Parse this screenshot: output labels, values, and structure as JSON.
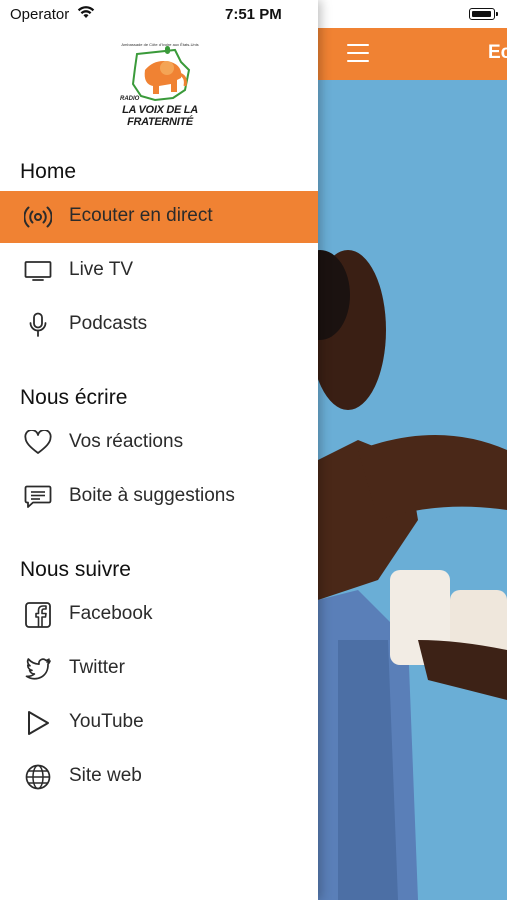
{
  "status_bar": {
    "carrier": "Operator",
    "time": "7:51 PM"
  },
  "logo": {
    "caption": "Ambassade de Côte d'Ivoire aux États-Unis",
    "radio": "RADIO",
    "name_line1": "LA VOIX DE LA",
    "name_line2": "FRATERNITÉ"
  },
  "main": {
    "title": "Ec"
  },
  "sections": {
    "home": "Home",
    "write": "Nous écrire",
    "follow": "Nous suivre"
  },
  "menu": {
    "listen": {
      "label": "Ecouter en direct",
      "icon": "broadcast-icon",
      "active": true
    },
    "livetv": {
      "label": "Live TV",
      "icon": "tv-icon"
    },
    "podcasts": {
      "label": "Podcasts",
      "icon": "microphone-icon"
    },
    "reactions": {
      "label": "Vos réactions",
      "icon": "heart-icon"
    },
    "suggestions": {
      "label": "Boite à suggestions",
      "icon": "message-icon"
    },
    "facebook": {
      "label": "Facebook",
      "icon": "facebook-icon"
    },
    "twitter": {
      "label": "Twitter",
      "icon": "twitter-icon"
    },
    "youtube": {
      "label": "YouTube",
      "icon": "play-icon"
    },
    "website": {
      "label": "Site web",
      "icon": "globe-icon"
    }
  },
  "colors": {
    "accent": "#f08233",
    "sky": "#6aaed6"
  }
}
